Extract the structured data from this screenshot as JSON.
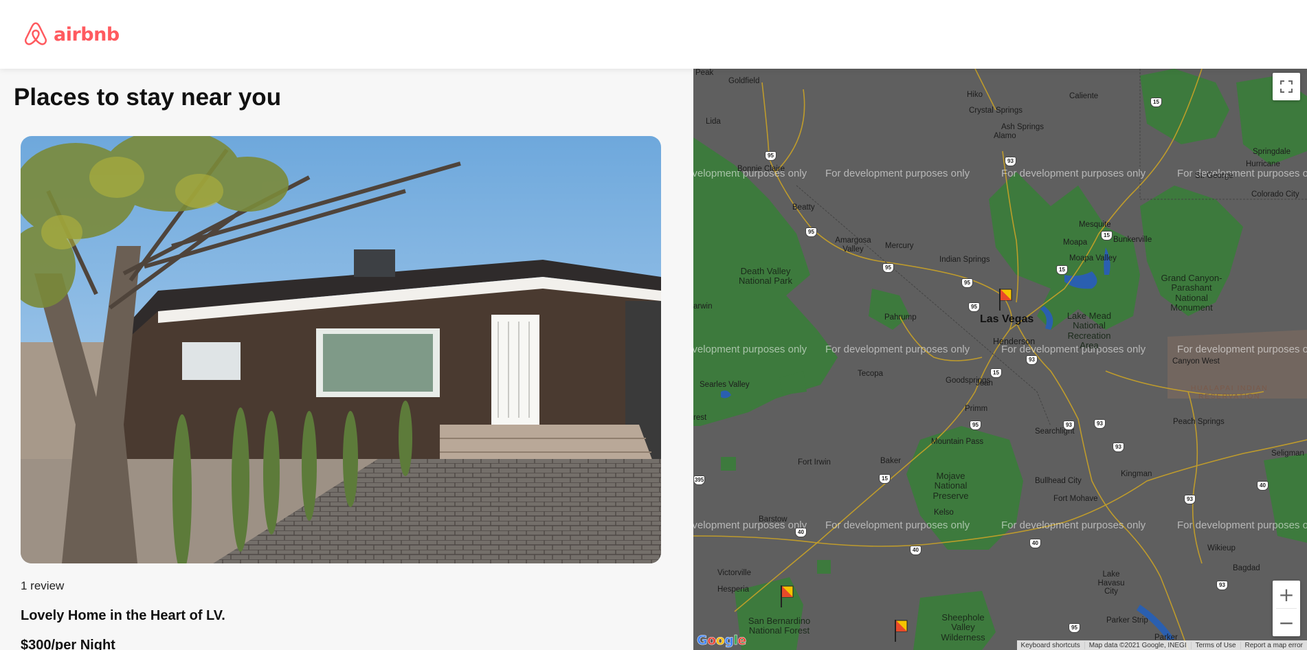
{
  "header": {
    "logo_text": "airbnb",
    "logo_icon": "airbnb-belo-icon",
    "brand_color": "#ff5a5f"
  },
  "main": {
    "title": "Places to stay near you",
    "listing": {
      "reviews": "1 review",
      "title": "Lovely Home in the Heart of LV.",
      "price": "$300/per Night"
    }
  },
  "map": {
    "watermark": "For development purposes only",
    "labels": {
      "peak": "Peak",
      "goldfield": "Goldfield",
      "hiko": "Hiko",
      "caliente": "Caliente",
      "crystal_springs": "Crystal Springs",
      "ash_springs": "Ash Springs",
      "alamo": "Alamo",
      "lida": "Lida",
      "bonnie_claire": "Bonnie Claire",
      "beatty": "Beatty",
      "amargosa_valley": "Amargosa Valley",
      "mercury": "Mercury",
      "indian_springs": "Indian Springs",
      "mesquite": "Mesquite",
      "bunkerville": "Bunkerville",
      "moapa": "Moapa",
      "moapa_valley": "Moapa Valley",
      "st_george": "St. George",
      "hurricane": "Hurricane",
      "springdale": "Springdale",
      "colorado_city": "Colorado City",
      "death_valley": "Death Valley National Park",
      "grand_canyon": "Grand Canyon-Parashant National Monument",
      "las_vegas": "Las Vegas",
      "henderson": "Henderson",
      "lake_mead": "Lake Mead National Recreation Area",
      "pahrump": "Pahrump",
      "darwin": "arwin",
      "tecopa": "Tecopa",
      "goodsprings": "Goodsprings",
      "jean": "Jean",
      "searles_valley": "Searles Valley",
      "primm": "Primm",
      "forest": "rest",
      "mountain_pass": "Mountain Pass",
      "searchlight": "Searchlight",
      "canyon_west": "Canyon West",
      "hualapai": "HUALAPAI INDIAN RESERVATION",
      "peach_springs": "Peach Springs",
      "fort_irwin": "Fort Irwin",
      "baker": "Baker",
      "mojave": "Mojave National Preserve",
      "bullhead_city": "Bullhead City",
      "kingman": "Kingman",
      "seligman": "Seligman",
      "fort_mohave": "Fort Mohave",
      "kelso": "Kelso",
      "barstow": "Barstow",
      "wikieup": "Wikieup",
      "bagdad": "Bagdad",
      "victorville": "Victorville",
      "hesperia": "Hesperia",
      "lake_havasu": "Lake Havasu City",
      "san_bernardino": "San Bernardino National Forest",
      "sheephole": "Sheephole Valley Wilderness",
      "parker_strip": "Parker Strip",
      "parker": "Parker"
    },
    "shields": [
      "95",
      "93",
      "15",
      "95",
      "95",
      "15",
      "95",
      "15",
      "95",
      "93",
      "15",
      "93",
      "40",
      "40",
      "93",
      "40",
      "95",
      "40",
      "93",
      "93",
      "93",
      "395",
      "15",
      "95"
    ],
    "controls": {
      "zoom_in": "+",
      "zoom_out": "−"
    },
    "google_logo": "Google",
    "attribution": [
      "Keyboard shortcuts",
      "Map data ©2021 Google, INEGI",
      "Terms of Use",
      "Report a map error"
    ],
    "colors": {
      "land": "#5f5f5f",
      "park": "#3d7a3d",
      "water": "#2a5fb0",
      "road": "#c9a227",
      "marker": "#f5c400"
    }
  }
}
